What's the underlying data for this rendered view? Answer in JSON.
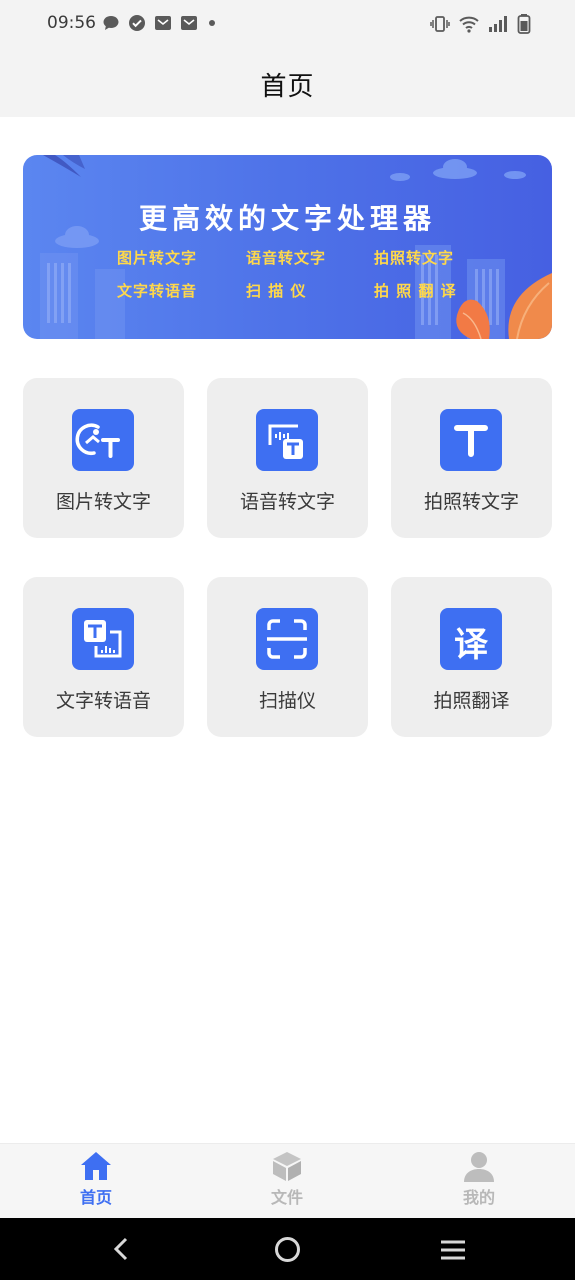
{
  "status": {
    "time": "09:56",
    "left_icons": [
      "chat-bubble-icon",
      "check-circle-icon",
      "mail-icon",
      "mail-icon",
      "dot-icon"
    ],
    "right_icons": [
      "vibrate-icon",
      "wifi-icon",
      "signal-icon",
      "battery-icon"
    ]
  },
  "header": {
    "title": "首页"
  },
  "banner": {
    "headline": "更高效的文字处理器",
    "features": [
      "图片转文字",
      "语音转文字",
      "拍照转文字",
      "文字转语音",
      "扫 描 仪",
      "拍 照 翻 译"
    ]
  },
  "features": [
    {
      "label": "图片转文字",
      "icon": "image-to-text-icon"
    },
    {
      "label": "语音转文字",
      "icon": "voice-to-text-icon"
    },
    {
      "label": "拍照转文字",
      "icon": "text-t-icon"
    },
    {
      "label": "文字转语音",
      "icon": "text-to-voice-icon"
    },
    {
      "label": "扫描仪",
      "icon": "scanner-icon"
    },
    {
      "label": "拍照翻译",
      "icon": "translate-icon",
      "glyph": "译"
    }
  ],
  "bottom_nav": {
    "items": [
      {
        "label": "首页",
        "icon": "home-icon",
        "active": true
      },
      {
        "label": "文件",
        "icon": "box-icon",
        "active": false
      },
      {
        "label": "我的",
        "icon": "user-icon",
        "active": false
      }
    ],
    "active_color": "#3e6ff2",
    "inactive_color": "#bdbdbd"
  },
  "colors": {
    "accent": "#3e6ff2",
    "banner_text": "#ffd84a"
  }
}
